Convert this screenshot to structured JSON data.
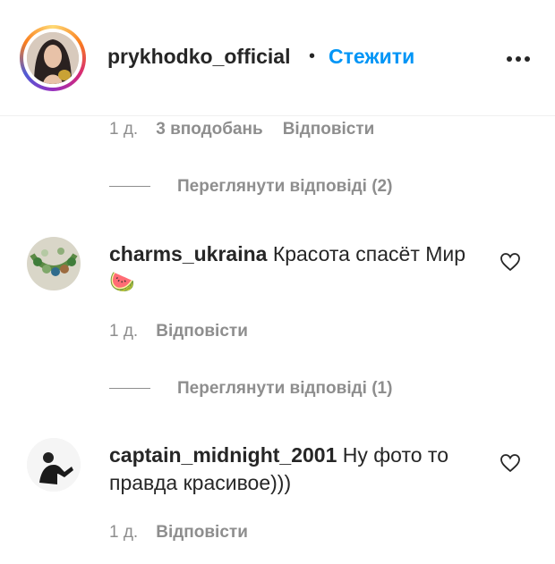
{
  "header": {
    "username": "prykhodko_official",
    "separator": "•",
    "follow_label": "Стежити",
    "more_icon": "more-horizontal-icon"
  },
  "post_meta": {
    "time": "1 д.",
    "likes": "3 вподобань",
    "reply_label": "Відповісти"
  },
  "view_replies_1": {
    "label": "Переглянути відповіді (2)"
  },
  "comments": [
    {
      "username": "charms_ukraina",
      "text": "Красота спасёт Мир 🍉",
      "time": "1 д.",
      "reply_label": "Відповісти",
      "view_replies": "Переглянути відповіді (1)"
    },
    {
      "username": "captain_midnight_2001",
      "text": "Ну фото то правда красивое)))",
      "time": "1 д.",
      "reply_label": "Відповісти"
    }
  ],
  "colors": {
    "accent": "#0095f6",
    "secondary_text": "#8e8e8e",
    "primary_text": "#262626"
  }
}
